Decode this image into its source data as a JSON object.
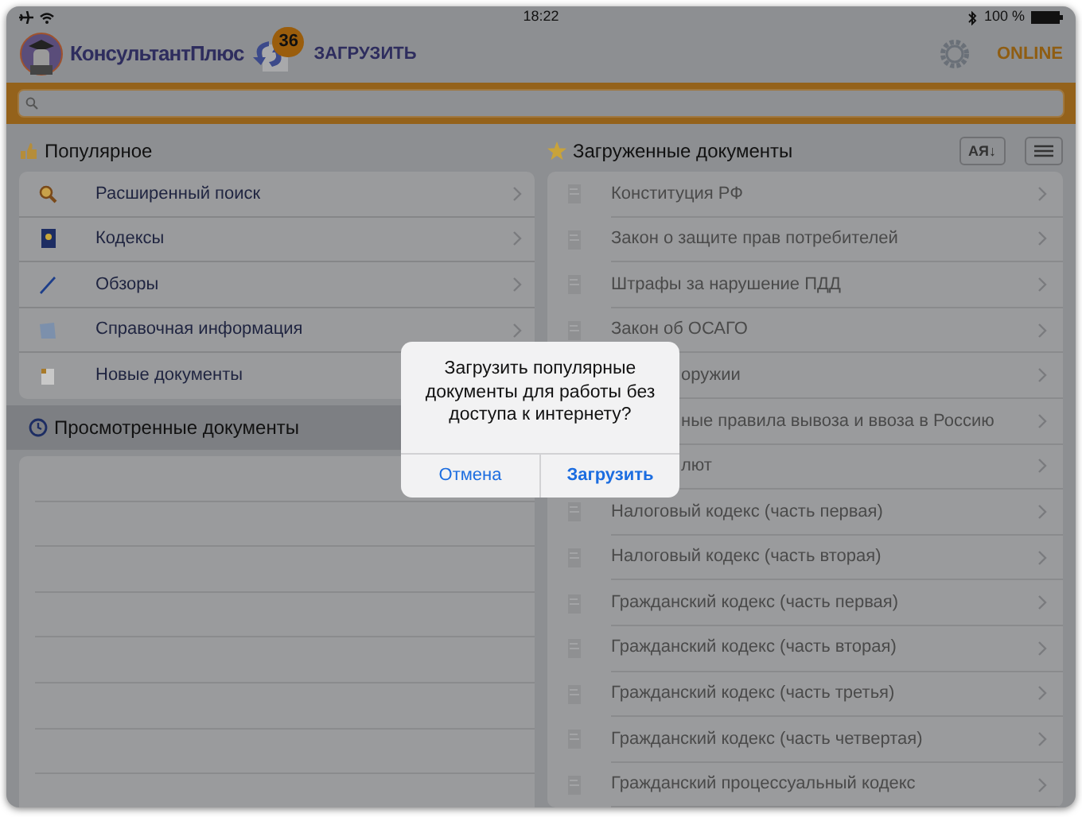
{
  "status_bar": {
    "time": "18:22",
    "battery_text": "100 %"
  },
  "header": {
    "app_name": "КонсультантПлюс",
    "update_badge": "36",
    "update_label": "ЗАГРУЗИТЬ",
    "mode": "ONLINE"
  },
  "popular": {
    "title": "Популярное",
    "items": [
      {
        "label": "Расширенный поиск",
        "kind": "full"
      },
      {
        "label": "Кодексы",
        "kind": "full"
      },
      {
        "label": "Обзоры",
        "kind": "full"
      },
      {
        "label": "Справочная информация",
        "kind": "full"
      },
      {
        "label": "Новые документы",
        "kind": "covered"
      }
    ]
  },
  "viewed": {
    "title": "Просмотренные документы"
  },
  "downloaded": {
    "title": "Загруженные документы",
    "sort_button": "АЯ↓",
    "items": [
      {
        "label": "Конституция РФ",
        "kind": "full"
      },
      {
        "label": "Закон о защите прав потребителей",
        "kind": "full"
      },
      {
        "label": "Штрафы за нарушение ПДД",
        "kind": "full"
      },
      {
        "label": "Закон об ОСАГО",
        "kind": "full"
      },
      {
        "label": "оружии",
        "kind": "covered"
      },
      {
        "label": "ные правила вывоза и ввоза в Россию",
        "kind": "covered"
      },
      {
        "label": "лют",
        "kind": "covered"
      },
      {
        "label": "Налоговый кодекс (часть первая)",
        "kind": "full"
      },
      {
        "label": "Налоговый кодекс (часть вторая)",
        "kind": "full"
      },
      {
        "label": "Гражданский кодекс (часть первая)",
        "kind": "full"
      },
      {
        "label": "Гражданский кодекс (часть вторая)",
        "kind": "full"
      },
      {
        "label": "Гражданский кодекс (часть третья)",
        "kind": "full"
      },
      {
        "label": "Гражданский кодекс (часть четвертая)",
        "kind": "full"
      },
      {
        "label": "Гражданский процессуальный кодекс",
        "kind": "full"
      }
    ]
  },
  "dialog": {
    "message": "Загрузить популярные документы для работы без доступа к интернету?",
    "buttons": [
      {
        "label": "Отмена",
        "primary": false
      },
      {
        "label": "Загрузить",
        "primary": true
      }
    ]
  }
}
